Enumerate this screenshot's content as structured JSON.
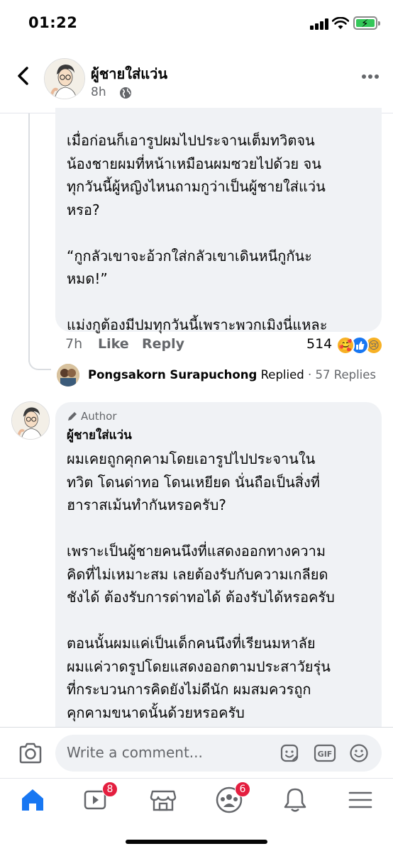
{
  "status_bar": {
    "time": "01:22"
  },
  "header": {
    "name": "ผู้ชายใส่แว่น",
    "time_ago": "8h"
  },
  "comment1": {
    "text": "เมื่อก่อนก็เอารูปผมไปประจานเต็มทวิตจน\nน้องชายผมที่หน้าเหมือนผมซวยไปด้วย จน\nทุกวันนี้ผู้หญิงไหนถามกูว่าเป็นผู้ชายใส่แว่น\nหรอ?\n\n“กูกลัวเขาจะอ้วกใส่กลัวเขาเดินหนีกูกันะ\nหมด!”\n\nแม่งกูต้องมีปมทุกวันนี้เพราะพวกเมิงนี่แหละ",
    "time": "7h",
    "like_label": "Like",
    "reply_label": "Reply",
    "reaction_count": "514",
    "reactions": [
      "care-icon",
      "like-icon",
      "sad-icon"
    ]
  },
  "replied_row": {
    "name": "Pongsakorn Surapuchong",
    "replied_label": "Replied",
    "separator": "·",
    "replies_count": "57 Replies"
  },
  "comment2": {
    "badge": "Author",
    "name": "ผู้ชายใส่แว่น",
    "text": "ผมเคยถูกคุกคามโดยเอารูปไปประจานใน\nทวิต โดนด่าทอ โดนเหยียด นั่นถือเป็นสิ่งที่\nฮาราสเม้นทำกันหรอครับ?\n\nเพราะเป็นผู้ชายคนนึงที่แสดงออกทางความ\nคิดที่ไม่เหมาะสม เลยต้องรับกับความเกลียด\nชังได้ ต้องรับการด่าทอได้ ต้องรับได้หรอครับ\n\nตอนนั้นผมแค่เป็นเด็กคนนึงที่เรียนมหาลัย\nผมแค่วาดรูปโดยแสดงออกตามประสาวัยรุ่น\nที่กระบวนการคิดยังไม่ดีนัก  ผมสมควรถูก\nคุกคามขนาดนั้นด้วยหรอครับ"
  },
  "input_bar": {
    "placeholder": "Write a comment...",
    "gif_label": "GIF"
  },
  "tab_bar": {
    "tabs": [
      {
        "icon": "home-icon",
        "active": true
      },
      {
        "icon": "watch-icon",
        "badge": "8"
      },
      {
        "icon": "marketplace-icon"
      },
      {
        "icon": "groups-icon",
        "badge": "6"
      },
      {
        "icon": "bell-icon"
      },
      {
        "icon": "menu-icon"
      }
    ]
  },
  "colors": {
    "accent": "#1877f2",
    "bubble": "#f0f2f5",
    "muted": "#65676b",
    "badge": "#e41e3f"
  }
}
